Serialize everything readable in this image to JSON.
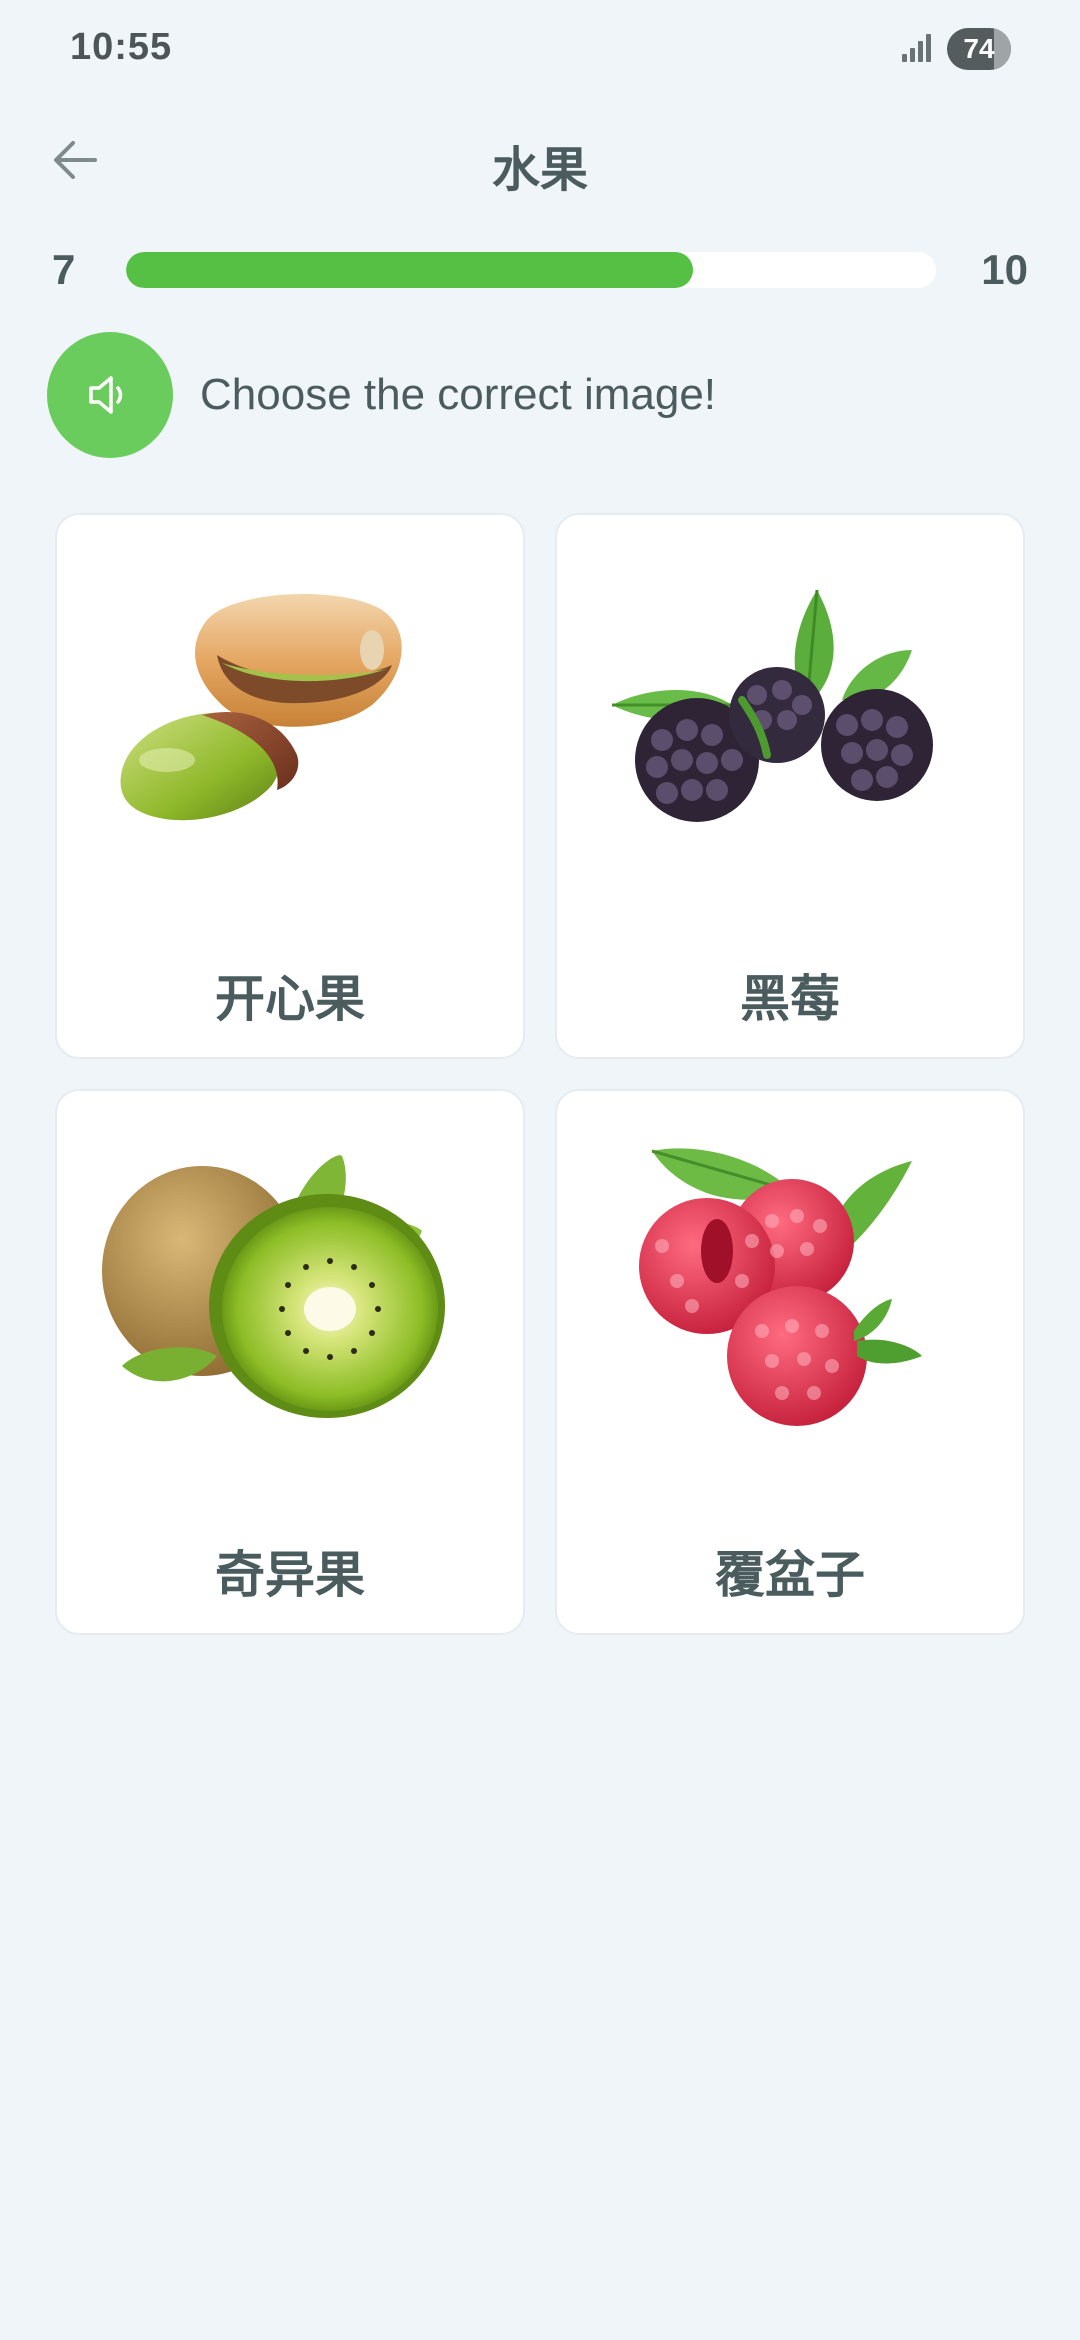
{
  "status_bar": {
    "time": "10:55",
    "battery_level": "74",
    "battery_fraction": 0.74,
    "signal_icon": "cellular-signal-icon"
  },
  "header": {
    "back_icon": "arrow-left-icon",
    "title": "水果"
  },
  "progress": {
    "current": "7",
    "total": "10",
    "fraction": 0.7,
    "fill_color": "#55c043"
  },
  "prompt": {
    "speaker_icon": "speaker-icon",
    "text": "Choose the correct image!"
  },
  "options": [
    {
      "label": "开心果",
      "image": "pistachio-image"
    },
    {
      "label": "黑莓",
      "image": "blackberry-image"
    },
    {
      "label": "奇异果",
      "image": "kiwi-image"
    },
    {
      "label": "覆盆子",
      "image": "raspberry-image"
    }
  ],
  "colors": {
    "background": "#f0f5f9",
    "accent_green": "#6acc5c",
    "text": "#4a5c5e"
  }
}
